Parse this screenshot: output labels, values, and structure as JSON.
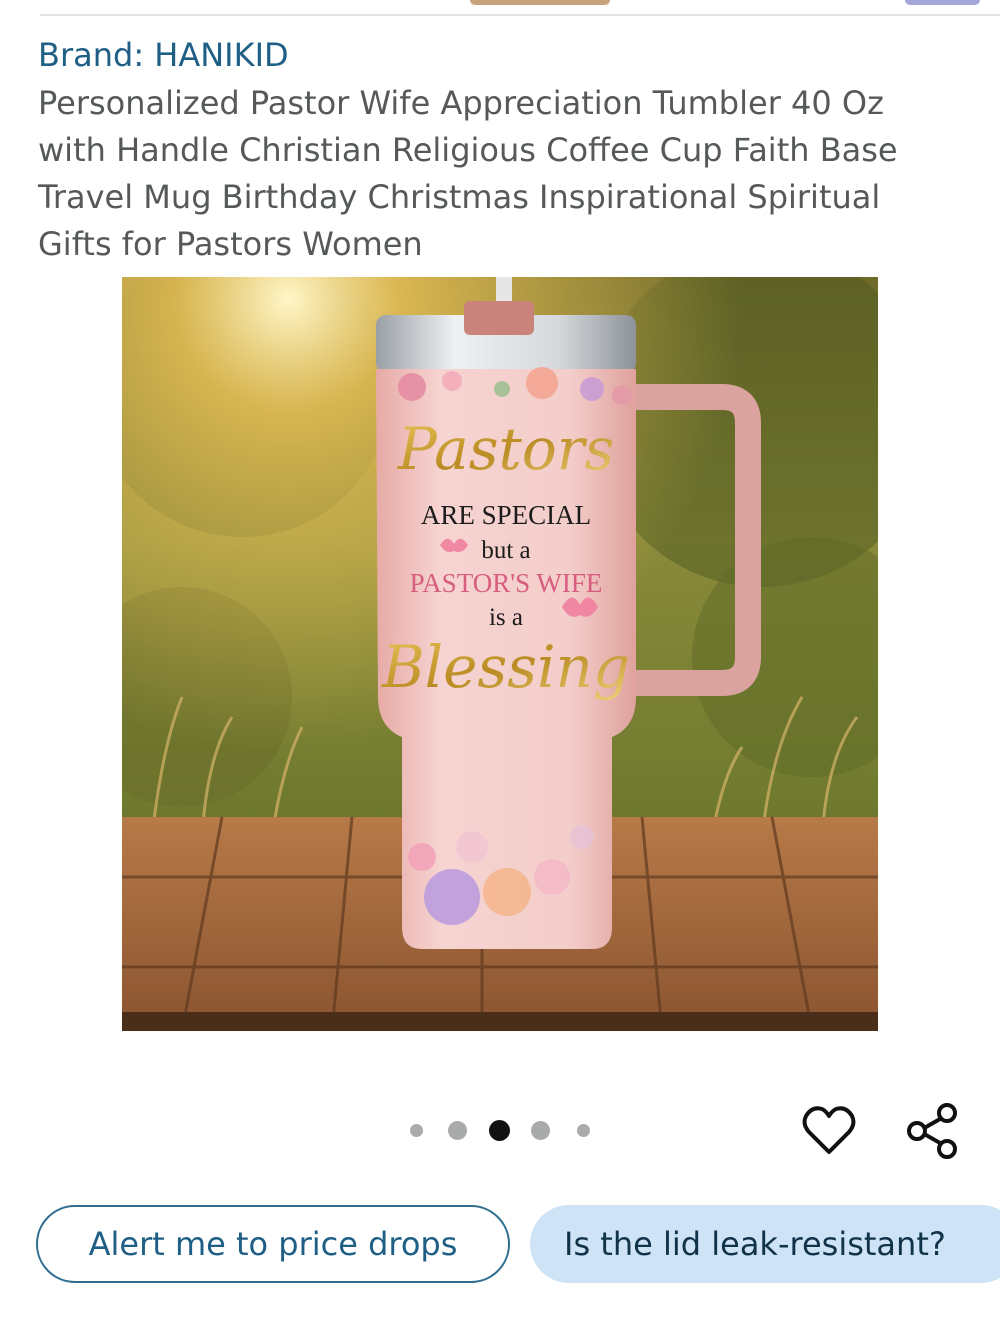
{
  "brand": {
    "text": "Brand: HANIKID"
  },
  "product": {
    "title": "Personalized Pastor Wife Appreciation Tumbler 40 Oz with Handle Christian Religious Coffee Cup Faith Base Travel Mug Birthday Christmas Inspirational Spiritual Gifts for Pastors Women",
    "image_text": {
      "line1": "Pastors",
      "line2": "ARE SPECIAL",
      "line3": "but a",
      "line4": "PASTOR'S WIFE",
      "line5": "is a",
      "line6": "Blessing"
    }
  },
  "carousel": {
    "total": 5,
    "active_index": 2
  },
  "actions": {
    "favorite_icon": "heart-icon",
    "share_icon": "share-icon"
  },
  "buttons": {
    "price_alert": "Alert me to price drops",
    "question": "Is the lid leak-resistant?"
  },
  "colors": {
    "link": "#1f5f85",
    "title": "#565959",
    "dot_active": "#111111",
    "dot_inactive": "#a9abab",
    "pill_filled_bg": "#cfe3f6"
  }
}
